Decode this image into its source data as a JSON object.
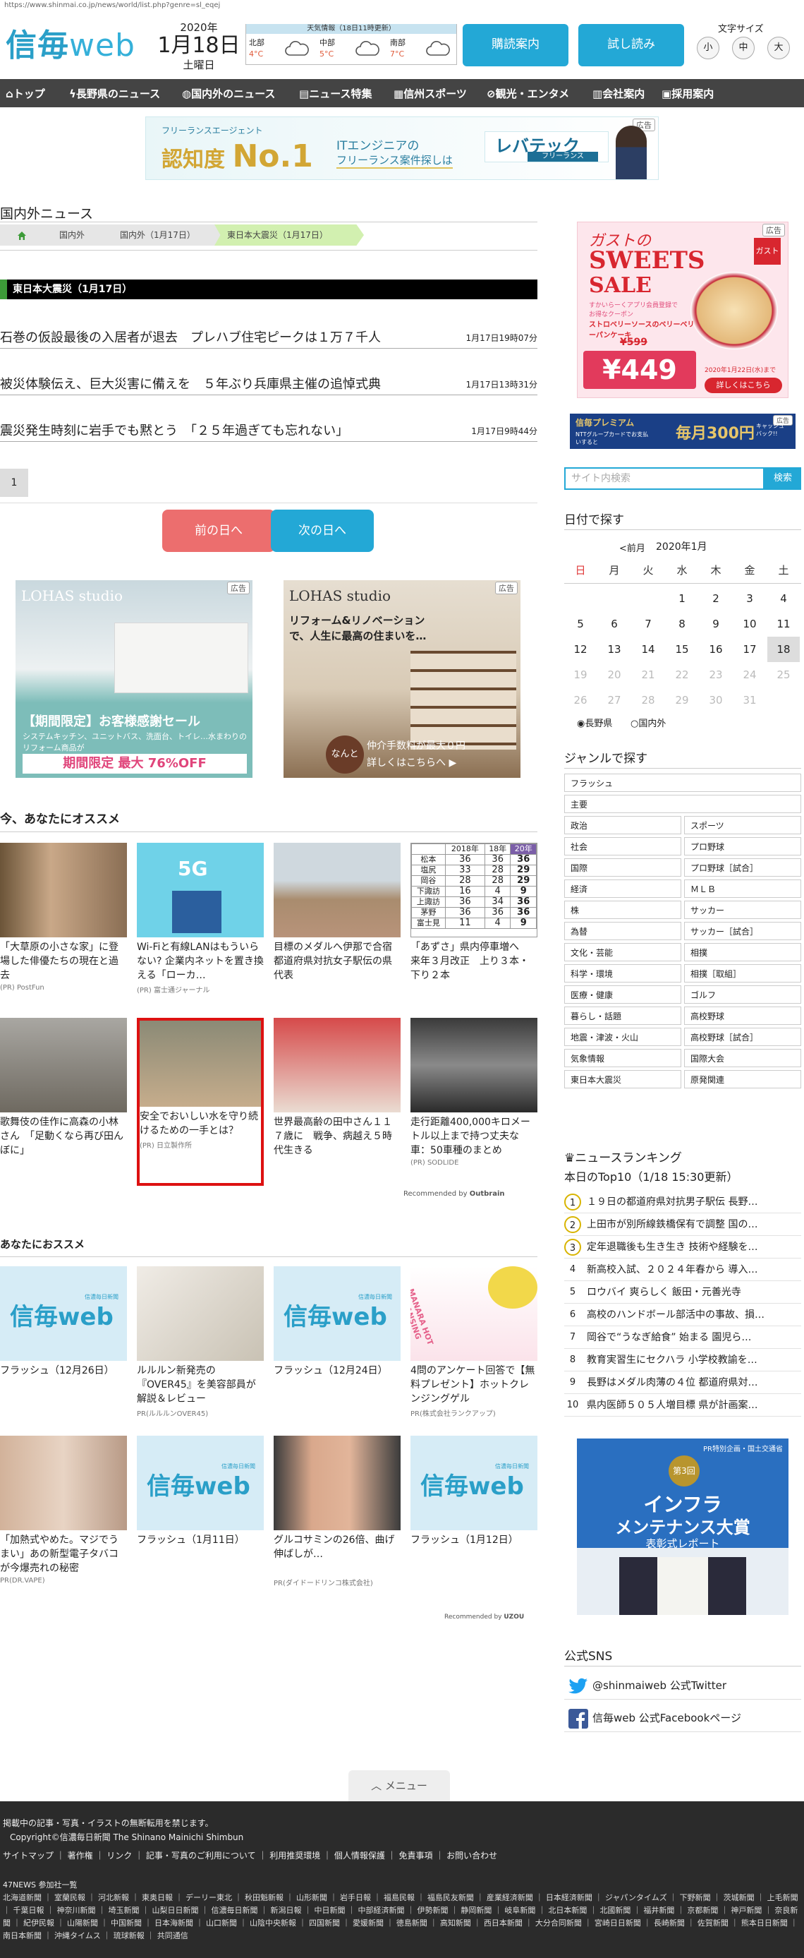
{
  "browser": {
    "url": "https://www.shinmai.co.jp/news/world/list.php?genre=sl_eqej"
  },
  "header": {
    "logo_main": "信毎",
    "logo_web": "web",
    "year": "2020年",
    "month_day": "1月18日",
    "weekday": "土曜日",
    "weather_title": "天気情報（18日11時更新）",
    "weather": [
      {
        "region": "北部",
        "temp": "4°C",
        "icon": "cloud-icon"
      },
      {
        "region": "中部",
        "temp": "5°C",
        "icon": "cloud-icon"
      },
      {
        "region": "南部",
        "temp": "7°C",
        "icon": "cloud-icon"
      }
    ],
    "btn_delivery": "購読案内",
    "btn_trial": "試し読み",
    "fontsize_label": "文字サイズ",
    "fontsize": [
      "小",
      "中",
      "大"
    ]
  },
  "nav": [
    {
      "icon": "home-icon",
      "label": "トップ"
    },
    {
      "icon": "lightning-icon",
      "label": "長野県のニュース"
    },
    {
      "icon": "globe-icon",
      "label": "国内外のニュース"
    },
    {
      "icon": "document-icon",
      "label": "ニュース特集"
    },
    {
      "icon": "sports-icon",
      "label": "信州スポーツ"
    },
    {
      "icon": "camera-icon",
      "label": "観光・エンタメ"
    },
    {
      "icon": "building-icon",
      "label": "会社案内"
    },
    {
      "icon": "briefcase-icon",
      "label": "採用案内"
    }
  ],
  "top_ad": {
    "label": "広告",
    "line1": "フリーランスエージェント",
    "line2": "認知度",
    "line3": "No.1",
    "line4": "ITエンジニアの",
    "line5": "フリーランス案件探しは",
    "brand": "レバテック",
    "brand_sub": "フリーランス"
  },
  "main": {
    "section_title": "国内外ニュース",
    "breadcrumb": [
      "国内外",
      "国内外（1月17日）",
      "東日本大震災（1月17日）"
    ],
    "topic_title": "東日本大震災（1月17日）",
    "news": [
      {
        "title": "石巻の仮設最後の入居者が退去　プレハブ住宅ピークは１万７千人",
        "time": "1月17日19時07分"
      },
      {
        "title": "被災体験伝え、巨大災害に備えを　５年ぶり兵庫県主催の追悼式典",
        "time": "1月17日13時31分"
      },
      {
        "title": "震災発生時刻に岩手でも黙とう　「２５年過ぎても忘れない」",
        "time": "1月17日9時44分"
      }
    ],
    "page_current": "1",
    "prev_day": "前の日へ",
    "next_day": "次の日へ",
    "ads": [
      {
        "label": "広告",
        "brand": "LOHAS studio",
        "title": "【期間限定】お客様感謝セール",
        "sub": "システムキッチン、ユニットバス、洗面台、トイレ…水まわりのリフォーム商品が",
        "foot": "期間限定 最大 76%OFF"
      },
      {
        "label": "広告",
        "brand": "LOHAS studio",
        "title": "リフォーム&リノベーションで、人生に最高の住まいを…",
        "badge": "なんと",
        "foot1": "仲介手数料が最大０円",
        "foot2": "詳しくはこちらへ ▶"
      }
    ],
    "rec_title": "今、あなたにオススメ",
    "rec_cards": [
      {
        "caption": "「大草原の小さな家」に登場した俳優たちの現在と過去",
        "source": "(PR) PostFun"
      },
      {
        "caption": "Wi-Fiと有線LANはもういらない? 企業内ネットを置き換える「ローカ…",
        "source": "(PR) 富士通ジャーナル",
        "img_text": "5G"
      },
      {
        "caption": "目標のメダルへ伊那で合宿　都道府県対抗女子駅伝の県代表",
        "source": ""
      },
      {
        "caption": "「あずさ」県内停車増へ　来年３月改正　上り３本・下り２本",
        "source": ""
      },
      {
        "caption": "歌舞伎の佳作に高森の小林さん　「足動くなら再び田んぼに」",
        "source": ""
      },
      {
        "caption": "安全でおいしい水を守り続けるための一手とは？",
        "source": "(PR) 日立製作所"
      },
      {
        "caption": "世界最高齢の田中さん１１７歳に　戦争、病越え５時代生きる",
        "source": ""
      },
      {
        "caption": "走行距離400,000キロメートル以上まで持つ丈夫な車：50車種のまとめ",
        "source": "(PR) SODLIDE"
      }
    ],
    "timetable": {
      "head": [
        "",
        "2018年",
        "18年",
        "20年"
      ],
      "rows": [
        [
          "松本",
          "36",
          "36",
          "36"
        ],
        [
          "塩尻",
          "33",
          "28",
          "29"
        ],
        [
          "岡谷",
          "28",
          "28",
          "29"
        ],
        [
          "下諏訪",
          "16",
          "4",
          "9"
        ],
        [
          "上諏訪",
          "36",
          "34",
          "36"
        ],
        [
          "茅野",
          "36",
          "36",
          "36"
        ],
        [
          "富士見",
          "11",
          "4",
          "9"
        ]
      ]
    },
    "outbrain": "Recommended by",
    "outbrain_brand": "Outbrain",
    "rec2_title": "あなたにおススメ",
    "rec2_cards": [
      {
        "caption": "フラッシュ（12月26日）",
        "source": "",
        "logo": true
      },
      {
        "caption": "ルルルン新発売の『OVER45』を美容部員が解説＆レビュー",
        "source": "PR(ルルルンOVER45)"
      },
      {
        "caption": "フラッシュ（12月24日）",
        "source": "",
        "logo": true
      },
      {
        "caption": "4問のアンケート回答で【無料プレゼント】ホットクレンジングゲル",
        "source": "PR(株式会社ランクアップ)",
        "img_text": "MANARA HOT CLEANSING GEL"
      },
      {
        "caption": "「加熱式やめた。マジでうまい」あの新型電子タバコが今爆売れの秘密",
        "source": "PR(DR.VAPE)"
      },
      {
        "caption": "フラッシュ（1月11日）",
        "source": "",
        "logo": true
      },
      {
        "caption": "グルコサミンの26倍、曲げ伸ばしが…",
        "source": "PR(ダイドードリンコ株式会社)"
      },
      {
        "caption": "フラッシュ（1月12日）",
        "source": "",
        "logo": true
      }
    ],
    "logo_sub": "信濃毎日新聞",
    "uzou": "Recommended by",
    "uzou_brand": "UZOU"
  },
  "sidebar": {
    "side_ad1": {
      "label": "広告",
      "title": "ガストの",
      "title2": "SWEETS",
      "title3": "SALE",
      "note": "すかいらーくアプリ会員登録でお得なクーポン",
      "item": "ストロベリーソースのベリーベリーパンケーキ",
      "old": "¥599",
      "price": "¥449",
      "date": "2020年1月22日(水)まで",
      "cta": "詳しくはこちら",
      "brand": "ガスト"
    },
    "side_ad2": {
      "label": "広告",
      "text": "信毎プレミアム",
      "sub": "NTTグループカードでお支払いすると",
      "big": "毎月300円",
      "tag": "キャッシュバック!!"
    },
    "search_placeholder": "サイト内検索",
    "search_btn": "検索",
    "date_title": "日付で探す",
    "cal_prev": "<前月",
    "cal_month": "2020年1月",
    "cal_head": [
      "日",
      "月",
      "火",
      "水",
      "木",
      "金",
      "土"
    ],
    "cal_rows": [
      [
        "",
        "",
        "",
        "1",
        "2",
        "3",
        "4"
      ],
      [
        "5",
        "6",
        "7",
        "8",
        "9",
        "10",
        "11"
      ],
      [
        "12",
        "13",
        "14",
        "15",
        "16",
        "17",
        "18"
      ],
      [
        "19",
        "20",
        "21",
        "22",
        "23",
        "24",
        "25"
      ],
      [
        "26",
        "27",
        "28",
        "29",
        "30",
        "31",
        ""
      ]
    ],
    "cal_radio": [
      "長野県",
      "国内外"
    ],
    "genre_title": "ジャンルで探す",
    "genre_full": [
      "フラッシュ",
      "主要"
    ],
    "genre_pairs": [
      [
        "政治",
        "スポーツ"
      ],
      [
        "社会",
        "プロ野球"
      ],
      [
        "国際",
        "プロ野球［試合］"
      ],
      [
        "経済",
        "ＭＬＢ"
      ],
      [
        "株",
        "サッカー"
      ],
      [
        "為替",
        "サッカー［試合］"
      ],
      [
        "文化・芸能",
        "相撲"
      ],
      [
        "科学・環境",
        "相撲［取組］"
      ],
      [
        "医療・健康",
        "ゴルフ"
      ],
      [
        "暮らし・話題",
        "高校野球"
      ],
      [
        "地震・津波・火山",
        "高校野球［試合］"
      ],
      [
        "気象情報",
        "国際大会"
      ],
      [
        "東日本大震災",
        "原発関連"
      ]
    ],
    "ranking_title": "ニュースランキング",
    "ranking_sub": "本日のTop10（1/18 15:30更新）",
    "ranking": [
      "１９日の都道府県対抗男子駅伝 長野…",
      "上田市が別所線鉄橋保有で調整 国の…",
      "定年退職後も生き生き 技術や経験を…",
      "新高校入試、２０２４年春から 導入…",
      "ロウバイ 爽らしく 飯田・元善光寺",
      "高校のハンドボール部活中の事故、損…",
      "岡谷で“うなぎ給食” 始まる 園児ら…",
      "教育実習生にセクハラ 小学校教諭を…",
      "長野はメダル肉薄の４位 都道府県対…",
      "県内医師５０５人増目標 県が計画案…"
    ],
    "infra_ad": {
      "tag": "PR特別企画・国土交通省",
      "num": "第3回",
      "t1": "インフラ",
      "t2": "メンテナンス大賞",
      "t3": "表彰式レポート"
    },
    "sns_title": "公式SNS",
    "sns": [
      {
        "icon": "twitter-icon",
        "label": "@shinmaiweb 公式Twitter"
      },
      {
        "icon": "facebook-icon",
        "label": "信毎web 公式Facebookページ"
      }
    ]
  },
  "footer": {
    "menu": "メニュー",
    "notice": "掲載中の記事・写真・イラストの無断転用を禁じます。",
    "copyright": "Copyright©信濃毎日新聞 The Shinano Mainichi Shimbun",
    "links": [
      "サイトマップ",
      "著作権",
      "リンク",
      "記事・写真のご利用について",
      "利用推奨環境",
      "個人情報保護",
      "免責事項",
      "お問い合わせ"
    ],
    "net_title": "47NEWS 参加社一覧",
    "papers": "北海道新聞 ｜ 室蘭民報 ｜ 河北新報 ｜ 東奥日報 ｜ デーリー東北 ｜ 秋田魁新報 ｜ 山形新聞 ｜ 岩手日報 ｜ 福島民報 ｜ 福島民友新聞 ｜ 産業経済新聞 ｜ 日本経済新聞 ｜ ジャパンタイムズ ｜ 下野新聞 ｜ 茨城新聞 ｜ 上毛新聞 ｜ 千葉日報 ｜ 神奈川新聞 ｜ 埼玉新聞 ｜ 山梨日日新聞 ｜ 信濃毎日新聞 ｜ 新潟日報 ｜ 中日新聞 ｜ 中部経済新聞 ｜ 伊勢新聞 ｜ 静岡新聞 ｜ 岐阜新聞 ｜ 北日本新聞 ｜ 北國新聞 ｜ 福井新聞 ｜ 京都新聞 ｜ 神戸新聞 ｜ 奈良新聞 ｜ 紀伊民報 ｜ 山陽新聞 ｜ 中国新聞 ｜ 日本海新聞 ｜ 山口新聞 ｜ 山陰中央新報 ｜ 四国新聞 ｜ 愛媛新聞 ｜ 徳島新聞 ｜ 高知新聞 ｜ 西日本新聞 ｜ 大分合同新聞 ｜ 宮崎日日新聞 ｜ 長崎新聞 ｜ 佐賀新聞 ｜ 熊本日日新聞 ｜ 南日本新聞 ｜ 沖縄タイムス ｜ 琉球新報 ｜ 共同通信"
  }
}
